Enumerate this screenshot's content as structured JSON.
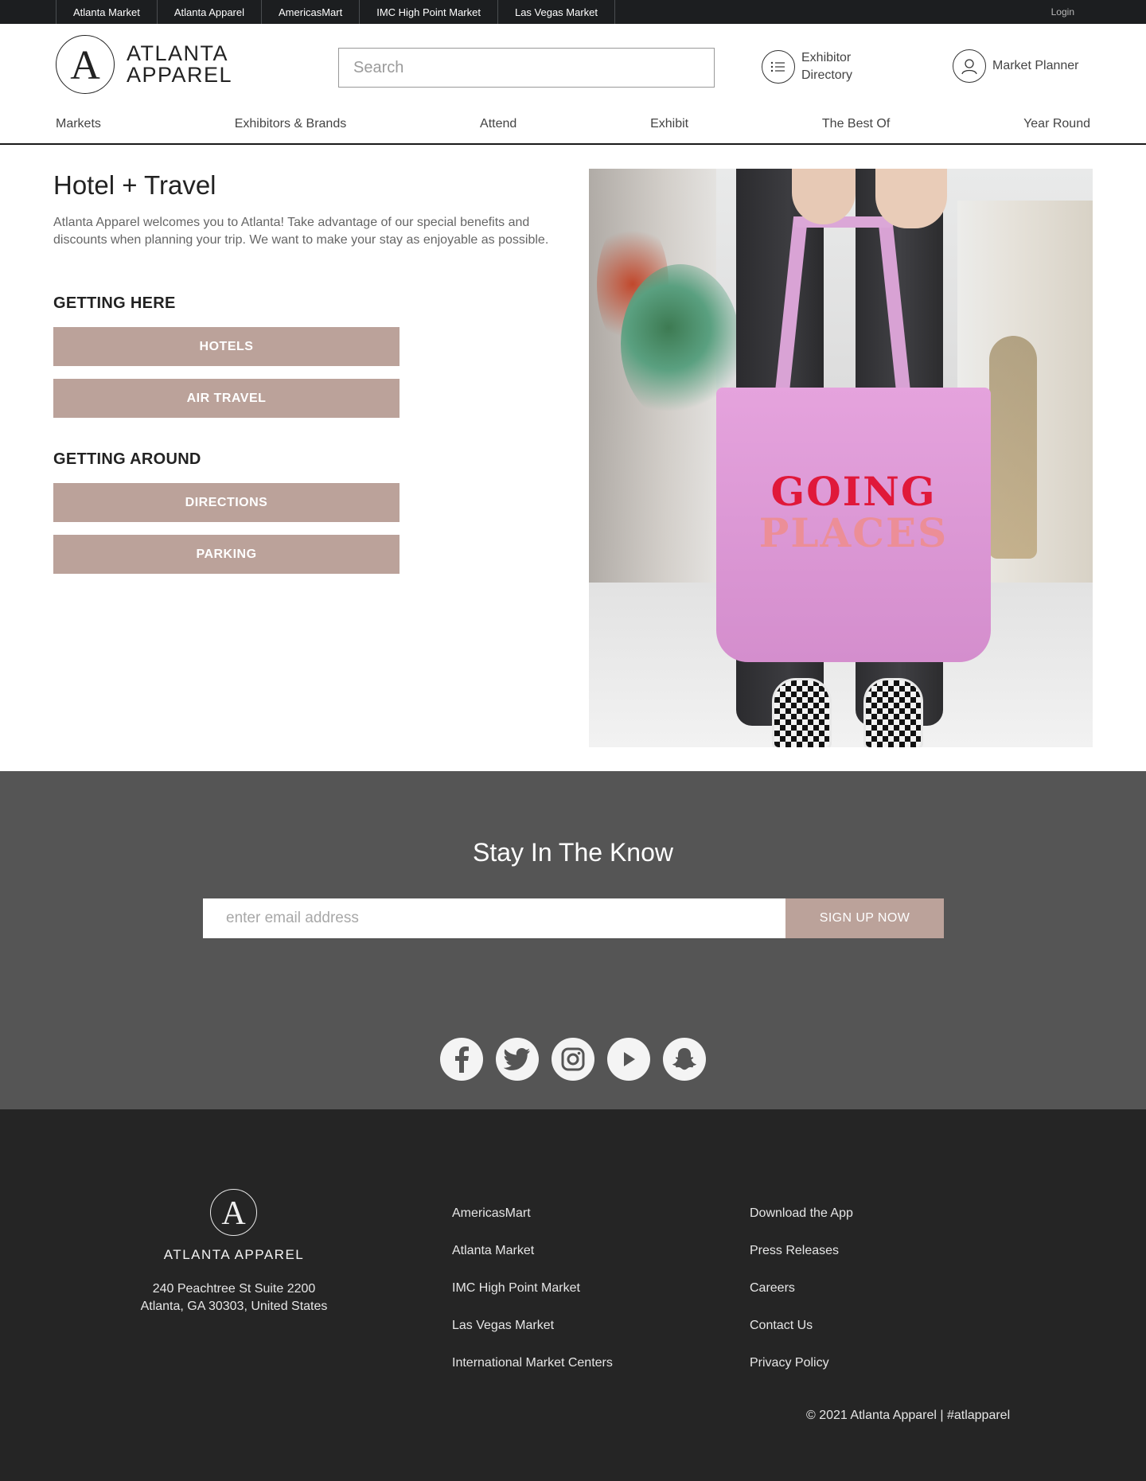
{
  "topbar": {
    "links": [
      "Atlanta Market",
      "Atlanta Apparel",
      "AmericasMart",
      "IMC High Point Market",
      "Las Vegas Market"
    ],
    "login": "Login"
  },
  "header": {
    "logo_letter": "A",
    "logo_line1": "ATLANTA",
    "logo_line2": "APPAREL",
    "search_placeholder": "Search",
    "exhibitor_directory_line1": "Exhibitor",
    "exhibitor_directory_line2": "Directory",
    "market_planner": "Market Planner",
    "icons": {
      "directory": "list-icon",
      "planner": "user-icon"
    }
  },
  "nav": {
    "items": [
      "Markets",
      "Exhibitors & Brands",
      "Attend",
      "Exhibit",
      "The Best Of",
      "Year Round"
    ]
  },
  "main": {
    "title": "Hotel + Travel",
    "intro": "Atlanta Apparel welcomes you to Atlanta! Take advantage of our special benefits and discounts when planning your trip. We want to make your stay as enjoyable as possible.",
    "getting_here": {
      "heading": "GETTING HERE",
      "buttons": [
        "HOTELS",
        "AIR TRAVEL"
      ]
    },
    "getting_around": {
      "heading": "GETTING AROUND",
      "buttons": [
        "DIRECTIONS",
        "PARKING"
      ]
    },
    "hero_bag_text": [
      "GOING",
      "PLACES"
    ]
  },
  "newsletter": {
    "title": "Stay In The Know",
    "email_placeholder": "enter email address",
    "signup_label": "SIGN UP NOW",
    "social": [
      "facebook-icon",
      "twitter-icon",
      "instagram-icon",
      "youtube-icon",
      "snapchat-icon"
    ]
  },
  "footer": {
    "logo_letter": "A",
    "brand": "ATLANTA APPAREL",
    "address_line1": "240 Peachtree St Suite 2200",
    "address_line2": "Atlanta, GA 30303, United States",
    "col1": [
      "AmericasMart",
      "Atlanta Market",
      "IMC High Point Market",
      "Las Vegas Market",
      "International Market Centers"
    ],
    "col2": [
      "Download the App",
      "Press Releases",
      "Careers",
      "Contact Us",
      "Privacy Policy"
    ],
    "copyright": "© 2021 Atlanta Apparel | #atlapparel"
  },
  "colors": {
    "topbar_bg": "#1c1e20",
    "accent_button": "#bba29a",
    "newsletter_bg": "#555555",
    "footer_bg": "#252525"
  }
}
